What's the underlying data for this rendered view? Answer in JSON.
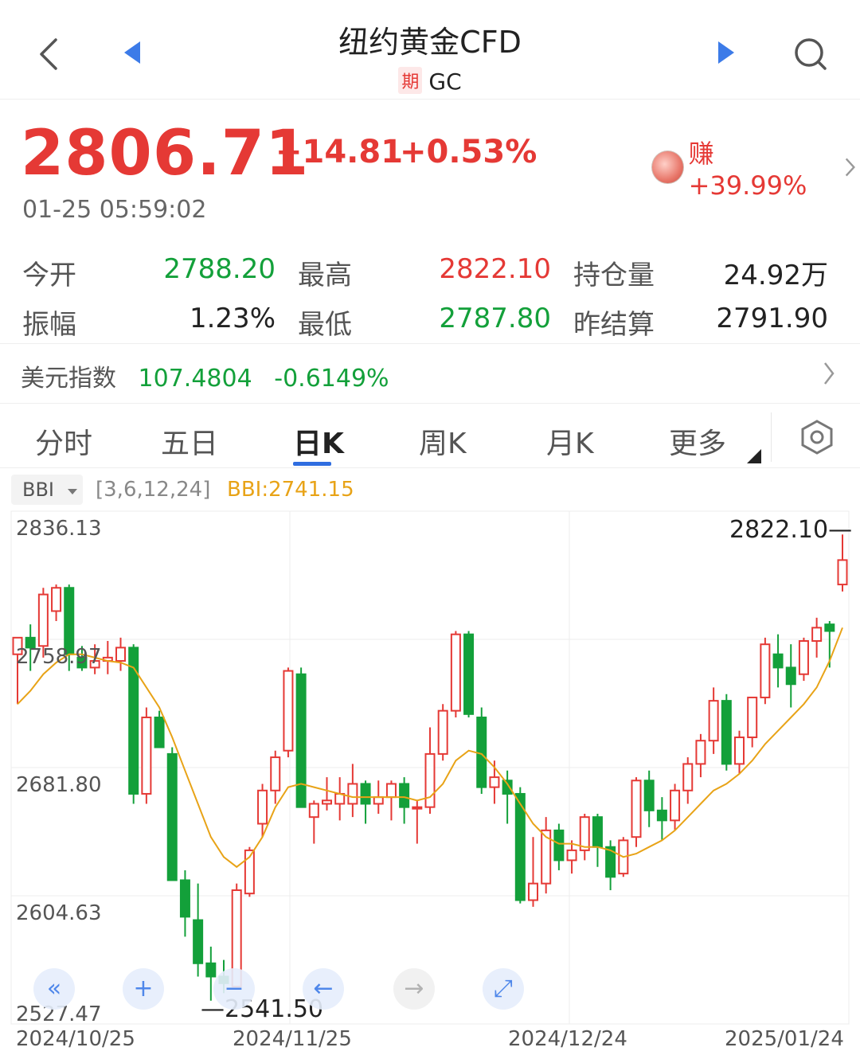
{
  "header": {
    "title": "纽约黄金CFD",
    "badge": "期",
    "code": "GC"
  },
  "quote": {
    "price": "2806.71",
    "change": "+14.81",
    "change_pct": "+0.53%",
    "time": "01-25 05:59:02",
    "earn": "赚+39.99%"
  },
  "stats": {
    "open_label": "今开",
    "open_value": "2788.20",
    "high_label": "最高",
    "high_value": "2822.10",
    "oi_label": "持仓量",
    "oi_value": "24.92万",
    "amp_label": "振幅",
    "amp_value": "1.23%",
    "low_label": "最低",
    "low_value": "2787.80",
    "settle_label": "昨结算",
    "settle_value": "2791.90"
  },
  "dxy": {
    "label": "美元指数",
    "value": "107.4804",
    "change_pct": "-0.6149%"
  },
  "tabs": [
    "分时",
    "五日",
    "日K",
    "周K",
    "月K",
    "更多"
  ],
  "active_tab": "日K",
  "indicator": {
    "name": "BBI",
    "params": "[3,6,12,24]",
    "value": "BBI:2741.15"
  },
  "colors": {
    "up": "#e53935",
    "down": "#13a03a",
    "bbi": "#e8a317",
    "accent": "#2f6de0"
  },
  "chart_data": {
    "type": "candlestick",
    "y_ticks": [
      "2836.13",
      "2758.97",
      "2681.80",
      "2604.63",
      "2527.47"
    ],
    "ylim": [
      2527.47,
      2836.13
    ],
    "x_ticks": [
      "2024/10/25",
      "2024/11/25",
      "2024/12/24",
      "2025/01/24"
    ],
    "max_label": "2822.10",
    "min_label": "2541.50",
    "candles": [
      {
        "o": 2750,
        "h": 2760,
        "l": 2720,
        "c": 2760
      },
      {
        "o": 2760,
        "h": 2768,
        "l": 2740,
        "c": 2754
      },
      {
        "o": 2755,
        "h": 2790,
        "l": 2748,
        "c": 2786
      },
      {
        "o": 2776,
        "h": 2792,
        "l": 2770,
        "c": 2790
      },
      {
        "o": 2790,
        "h": 2792,
        "l": 2740,
        "c": 2750
      },
      {
        "o": 2748,
        "h": 2755,
        "l": 2740,
        "c": 2742
      },
      {
        "o": 2742,
        "h": 2756,
        "l": 2738,
        "c": 2746
      },
      {
        "o": 2746,
        "h": 2758,
        "l": 2738,
        "c": 2748
      },
      {
        "o": 2746,
        "h": 2760,
        "l": 2740,
        "c": 2754
      },
      {
        "o": 2754,
        "h": 2756,
        "l": 2660,
        "c": 2666
      },
      {
        "o": 2666,
        "h": 2718,
        "l": 2660,
        "c": 2712
      },
      {
        "o": 2712,
        "h": 2716,
        "l": 2694,
        "c": 2694
      },
      {
        "o": 2690,
        "h": 2694,
        "l": 2614,
        "c": 2614
      },
      {
        "o": 2614,
        "h": 2620,
        "l": 2580,
        "c": 2592
      },
      {
        "o": 2590,
        "h": 2612,
        "l": 2556,
        "c": 2564
      },
      {
        "o": 2564,
        "h": 2574,
        "l": 2541.5,
        "c": 2556
      },
      {
        "o": 2556,
        "h": 2566,
        "l": 2546,
        "c": 2552
      },
      {
        "o": 2550,
        "h": 2612,
        "l": 2550,
        "c": 2608
      },
      {
        "o": 2606,
        "h": 2634,
        "l": 2604,
        "c": 2632
      },
      {
        "o": 2648,
        "h": 2672,
        "l": 2640,
        "c": 2668
      },
      {
        "o": 2668,
        "h": 2692,
        "l": 2660,
        "c": 2688
      },
      {
        "o": 2692,
        "h": 2742,
        "l": 2688,
        "c": 2740
      },
      {
        "o": 2738,
        "h": 2742,
        "l": 2660,
        "c": 2658
      },
      {
        "o": 2652,
        "h": 2662,
        "l": 2636,
        "c": 2660
      },
      {
        "o": 2660,
        "h": 2676,
        "l": 2656,
        "c": 2662
      },
      {
        "o": 2660,
        "h": 2676,
        "l": 2650,
        "c": 2666
      },
      {
        "o": 2660,
        "h": 2684,
        "l": 2652,
        "c": 2672
      },
      {
        "o": 2672,
        "h": 2674,
        "l": 2648,
        "c": 2660
      },
      {
        "o": 2660,
        "h": 2674,
        "l": 2654,
        "c": 2664
      },
      {
        "o": 2664,
        "h": 2674,
        "l": 2650,
        "c": 2672
      },
      {
        "o": 2672,
        "h": 2676,
        "l": 2648,
        "c": 2658
      },
      {
        "o": 2658,
        "h": 2662,
        "l": 2636,
        "c": 2658
      },
      {
        "o": 2658,
        "h": 2706,
        "l": 2654,
        "c": 2690
      },
      {
        "o": 2690,
        "h": 2720,
        "l": 2686,
        "c": 2716
      },
      {
        "o": 2716,
        "h": 2764,
        "l": 2712,
        "c": 2762
      },
      {
        "o": 2762,
        "h": 2764,
        "l": 2712,
        "c": 2714
      },
      {
        "o": 2712,
        "h": 2718,
        "l": 2666,
        "c": 2670
      },
      {
        "o": 2670,
        "h": 2686,
        "l": 2660,
        "c": 2676
      },
      {
        "o": 2674,
        "h": 2680,
        "l": 2648,
        "c": 2666
      },
      {
        "o": 2666,
        "h": 2670,
        "l": 2600,
        "c": 2602
      },
      {
        "o": 2602,
        "h": 2640,
        "l": 2598,
        "c": 2612
      },
      {
        "o": 2612,
        "h": 2652,
        "l": 2606,
        "c": 2644
      },
      {
        "o": 2644,
        "h": 2648,
        "l": 2620,
        "c": 2626
      },
      {
        "o": 2626,
        "h": 2638,
        "l": 2618,
        "c": 2632
      },
      {
        "o": 2632,
        "h": 2654,
        "l": 2626,
        "c": 2652
      },
      {
        "o": 2652,
        "h": 2654,
        "l": 2622,
        "c": 2634
      },
      {
        "o": 2634,
        "h": 2638,
        "l": 2608,
        "c": 2616
      },
      {
        "o": 2618,
        "h": 2640,
        "l": 2616,
        "c": 2638
      },
      {
        "o": 2640,
        "h": 2676,
        "l": 2634,
        "c": 2674
      },
      {
        "o": 2674,
        "h": 2680,
        "l": 2646,
        "c": 2656
      },
      {
        "o": 2656,
        "h": 2664,
        "l": 2638,
        "c": 2650
      },
      {
        "o": 2650,
        "h": 2672,
        "l": 2644,
        "c": 2668
      },
      {
        "o": 2668,
        "h": 2688,
        "l": 2660,
        "c": 2684
      },
      {
        "o": 2684,
        "h": 2702,
        "l": 2676,
        "c": 2698
      },
      {
        "o": 2698,
        "h": 2730,
        "l": 2690,
        "c": 2722
      },
      {
        "o": 2722,
        "h": 2726,
        "l": 2680,
        "c": 2684
      },
      {
        "o": 2684,
        "h": 2704,
        "l": 2678,
        "c": 2700
      },
      {
        "o": 2700,
        "h": 2724,
        "l": 2694,
        "c": 2724
      },
      {
        "o": 2724,
        "h": 2760,
        "l": 2720,
        "c": 2756
      },
      {
        "o": 2750,
        "h": 2762,
        "l": 2730,
        "c": 2742
      },
      {
        "o": 2742,
        "h": 2756,
        "l": 2718,
        "c": 2732
      },
      {
        "o": 2738,
        "h": 2760,
        "l": 2734,
        "c": 2758
      },
      {
        "o": 2758,
        "h": 2772,
        "l": 2748,
        "c": 2766
      },
      {
        "o": 2768,
        "h": 2770,
        "l": 2742,
        "c": 2764
      },
      {
        "o": 2792,
        "h": 2822.1,
        "l": 2787.8,
        "c": 2806.71
      }
    ],
    "bbi": [
      2720,
      2728,
      2738,
      2745,
      2750,
      2750,
      2748,
      2746,
      2745,
      2742,
      2730,
      2718,
      2700,
      2680,
      2660,
      2640,
      2628,
      2622,
      2628,
      2640,
      2658,
      2670,
      2672,
      2670,
      2668,
      2666,
      2664,
      2664,
      2664,
      2664,
      2664,
      2662,
      2664,
      2672,
      2686,
      2692,
      2690,
      2682,
      2672,
      2660,
      2648,
      2640,
      2636,
      2636,
      2634,
      2634,
      2632,
      2628,
      2630,
      2634,
      2638,
      2644,
      2652,
      2660,
      2668,
      2672,
      2678,
      2686,
      2696,
      2704,
      2712,
      2720,
      2730,
      2746,
      2766
    ]
  },
  "controls": [
    "«",
    "+",
    "−",
    "←",
    "→",
    "⤢"
  ]
}
